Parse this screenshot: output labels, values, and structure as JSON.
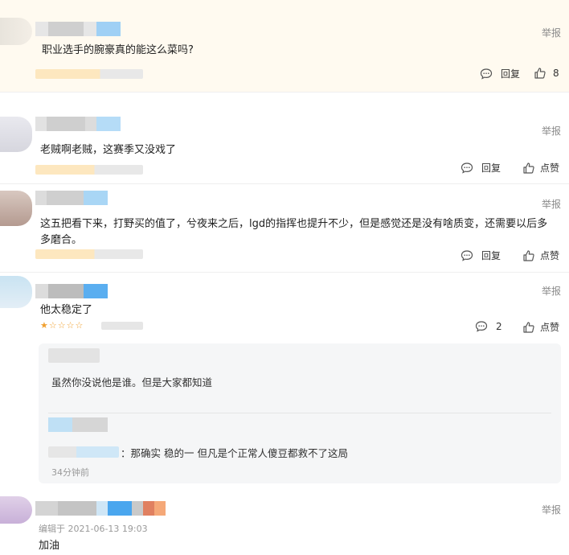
{
  "comments": [
    {
      "report_label": "举报",
      "text": "职业选手的腕豪真的能这么菜吗?",
      "reply_label": "回复",
      "like_count": "8"
    },
    {
      "report_label": "举报",
      "text": "老贼啊老贼，这赛季又没戏了",
      "reply_label": "回复",
      "like_label": "点赞"
    },
    {
      "report_label": "举报",
      "text": "这五把看下来，打野买的值了，兮夜来之后，lgd的指挥也提升不少，但是感觉还是没有啥质变，还需要以后多多磨合。",
      "reply_label": "回复",
      "like_label": "点赞"
    },
    {
      "report_label": "举报",
      "text": "他太稳定了",
      "rating_stars": "★☆☆☆☆",
      "reply_count": "2",
      "like_label": "点赞",
      "replies": [
        {
          "text": "虽然你没说他是谁。但是大家都知道"
        },
        {
          "text": "：那确实 稳的一 但凡是个正常人傻豆都救不了这局",
          "time": "34分钟前"
        }
      ]
    },
    {
      "report_label": "举报",
      "edited_label": "编辑于 2021-06-13 19:03",
      "text": "加油"
    }
  ],
  "colors": {
    "highlight_bg": "#fffaf0",
    "star": "#f0a030",
    "muted": "#8a8a8a"
  },
  "icons": [
    "comment-bubble-icon",
    "thumbs-up-icon"
  ]
}
